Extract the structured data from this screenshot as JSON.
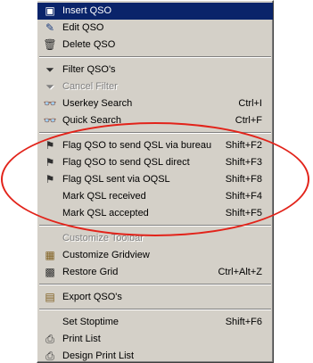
{
  "menu": {
    "groups": [
      [
        {
          "name": "insert-qso-item",
          "icon": "insert-qso-icon",
          "icon_char": "▣",
          "icon_color": "#cc2020",
          "label": "Insert QSO",
          "shortcut": "",
          "selected": true,
          "disabled": false
        },
        {
          "name": "edit-qso-item",
          "icon": "edit-qso-icon",
          "icon_char": "✎",
          "icon_color": "#204080",
          "label": "Edit QSO",
          "shortcut": "",
          "selected": false,
          "disabled": false
        },
        {
          "name": "delete-qso-item",
          "icon": "trash-icon",
          "icon_char": "🗑",
          "icon_color": "#303030",
          "label": "Delete QSO",
          "shortcut": "",
          "selected": false,
          "disabled": false
        }
      ],
      [
        {
          "name": "filter-qsos-item",
          "icon": "filter-icon",
          "icon_char": "⏷",
          "icon_color": "#303030",
          "label": "Filter QSO's",
          "shortcut": "",
          "selected": false,
          "disabled": false
        },
        {
          "name": "cancel-filter-item",
          "icon": "cancel-filter-icon",
          "icon_char": "⏷",
          "icon_color": "#808080",
          "label": "Cancel Filter",
          "shortcut": "",
          "selected": false,
          "disabled": true
        },
        {
          "name": "userkey-search-item",
          "icon": "binoculars-icon",
          "icon_char": "👓",
          "icon_color": "#202020",
          "label": "Userkey Search",
          "shortcut": "Ctrl+I",
          "selected": false,
          "disabled": false
        },
        {
          "name": "quick-search-item",
          "icon": "binoculars-icon",
          "icon_char": "👓",
          "icon_color": "#202020",
          "label": "Quick Search",
          "shortcut": "Ctrl+F",
          "selected": false,
          "disabled": false
        }
      ],
      [
        {
          "name": "flag-qsl-bureau-item",
          "icon": "flag-icon",
          "icon_char": "⚑",
          "icon_color": "#303030",
          "label": "Flag QSO to send QSL via bureau",
          "shortcut": "Shift+F2",
          "selected": false,
          "disabled": false
        },
        {
          "name": "flag-qsl-direct-item",
          "icon": "flag-icon",
          "icon_char": "⚑",
          "icon_color": "#303030",
          "label": "Flag QSO to send QSL direct",
          "shortcut": "Shift+F3",
          "selected": false,
          "disabled": false
        },
        {
          "name": "flag-qsl-oqsl-item",
          "icon": "flag-icon",
          "icon_char": "⚑",
          "icon_color": "#303030",
          "label": "Flag QSL sent via OQSL",
          "shortcut": "Shift+F8",
          "selected": false,
          "disabled": false
        },
        {
          "name": "mark-qsl-received-item",
          "icon": "",
          "icon_char": "",
          "icon_color": "",
          "label": "Mark QSL received",
          "shortcut": "Shift+F4",
          "selected": false,
          "disabled": false
        },
        {
          "name": "mark-qsl-accepted-item",
          "icon": "",
          "icon_char": "",
          "icon_color": "",
          "label": "Mark QSL accepted",
          "shortcut": "Shift+F5",
          "selected": false,
          "disabled": false
        }
      ],
      [
        {
          "name": "customize-toolbar-item",
          "icon": "",
          "icon_char": "",
          "icon_color": "",
          "label": "Customize Toolbar",
          "shortcut": "",
          "selected": false,
          "disabled": true
        },
        {
          "name": "customize-gridview-item",
          "icon": "grid-icon",
          "icon_char": "▦",
          "icon_color": "#806020",
          "label": "Customize Gridview",
          "shortcut": "",
          "selected": false,
          "disabled": false
        },
        {
          "name": "restore-grid-item",
          "icon": "restore-grid-icon",
          "icon_char": "▩",
          "icon_color": "#303030",
          "label": "Restore Grid",
          "shortcut": "Ctrl+Alt+Z",
          "selected": false,
          "disabled": false
        }
      ],
      [
        {
          "name": "export-qsos-item",
          "icon": "export-icon",
          "icon_char": "▤",
          "icon_color": "#806020",
          "label": "Export QSO's",
          "shortcut": "",
          "selected": false,
          "disabled": false
        }
      ],
      [
        {
          "name": "set-stoptime-item",
          "icon": "",
          "icon_char": "",
          "icon_color": "",
          "label": "Set Stoptime",
          "shortcut": "Shift+F6",
          "selected": false,
          "disabled": false
        },
        {
          "name": "print-list-item",
          "icon": "printer-icon",
          "icon_char": "⎙",
          "icon_color": "#303030",
          "label": "Print List",
          "shortcut": "",
          "selected": false,
          "disabled": false
        },
        {
          "name": "design-print-list-item",
          "icon": "design-print-icon",
          "icon_char": "⎙",
          "icon_color": "#303030",
          "label": "Design Print List",
          "shortcut": "",
          "selected": false,
          "disabled": false
        }
      ]
    ]
  },
  "annotation": {
    "color": "#e2231a"
  }
}
